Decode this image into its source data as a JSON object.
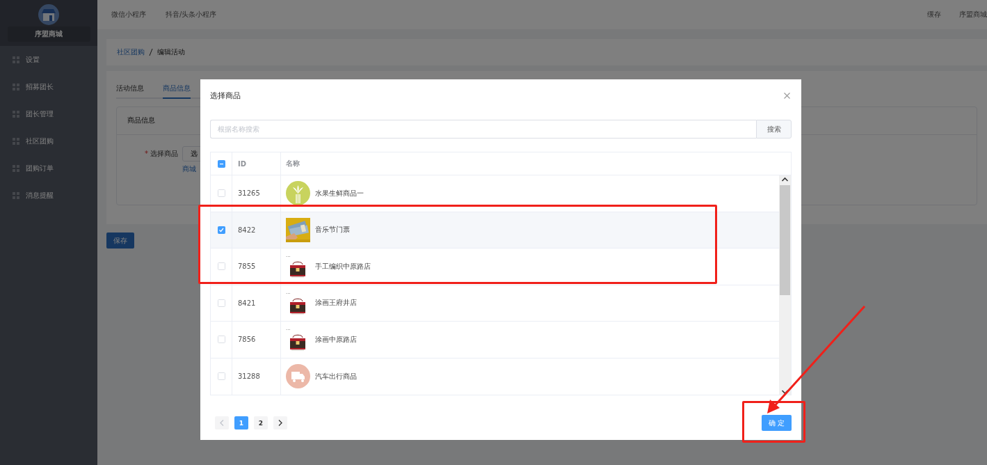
{
  "sidebar": {
    "brand": "序盟商城",
    "items": [
      {
        "label": "设置"
      },
      {
        "label": "招募团长"
      },
      {
        "label": "团长管理"
      },
      {
        "label": "社区团购"
      },
      {
        "label": "团购订单"
      },
      {
        "label": "消息提醒"
      }
    ]
  },
  "top_nav": {
    "left": [
      "微信小程序",
      "抖音/头条小程序"
    ],
    "right": [
      "缓存",
      "序盟商城"
    ]
  },
  "breadcrumb": [
    "社区团购",
    "编辑活动"
  ],
  "tabs": [
    {
      "label": "活动信息",
      "selected": false
    },
    {
      "label": "商品信息",
      "selected": true
    }
  ],
  "section": {
    "title": "商品信息",
    "required_mark": "*",
    "field_label": "选择商品",
    "button": "选",
    "link": "商城"
  },
  "save_button": "保存",
  "dialog": {
    "title": "选择商品",
    "search": {
      "placeholder": "根据名称搜索",
      "button": "搜索"
    },
    "table": {
      "select_all": {
        "checked": false,
        "partial": true
      },
      "columns": [
        "ID",
        "名称"
      ],
      "rows": [
        {
          "id": "31265",
          "name": "水果生鲜商品一",
          "selected": false,
          "thumb": {
            "kind": "wheat"
          }
        },
        {
          "id": "8422",
          "name": "音乐节门票",
          "selected": true,
          "thumb": {
            "kind": "tickets"
          }
        },
        {
          "id": "7855",
          "name": "手工编织中原路店",
          "selected": false,
          "thumb": {
            "kind": "bag"
          },
          "caption": "..."
        },
        {
          "id": "8421",
          "name": "涂画王府井店",
          "selected": false,
          "thumb": {
            "kind": "bag"
          },
          "caption": "..."
        },
        {
          "id": "7856",
          "name": "涂画中原路店",
          "selected": false,
          "thumb": {
            "kind": "bag"
          },
          "caption": "..."
        },
        {
          "id": "31288",
          "name": "汽车出行商品",
          "selected": false,
          "thumb": {
            "kind": "truck"
          }
        }
      ]
    },
    "pagination": {
      "prev_disabled": true,
      "pages": [
        {
          "label": "1",
          "selected": true
        },
        {
          "label": "2",
          "selected": false
        }
      ]
    },
    "confirm": "确 定"
  },
  "annotations": [
    {
      "kind": "box"
    },
    {
      "kind": "box"
    },
    {
      "kind": "arrow"
    }
  ]
}
